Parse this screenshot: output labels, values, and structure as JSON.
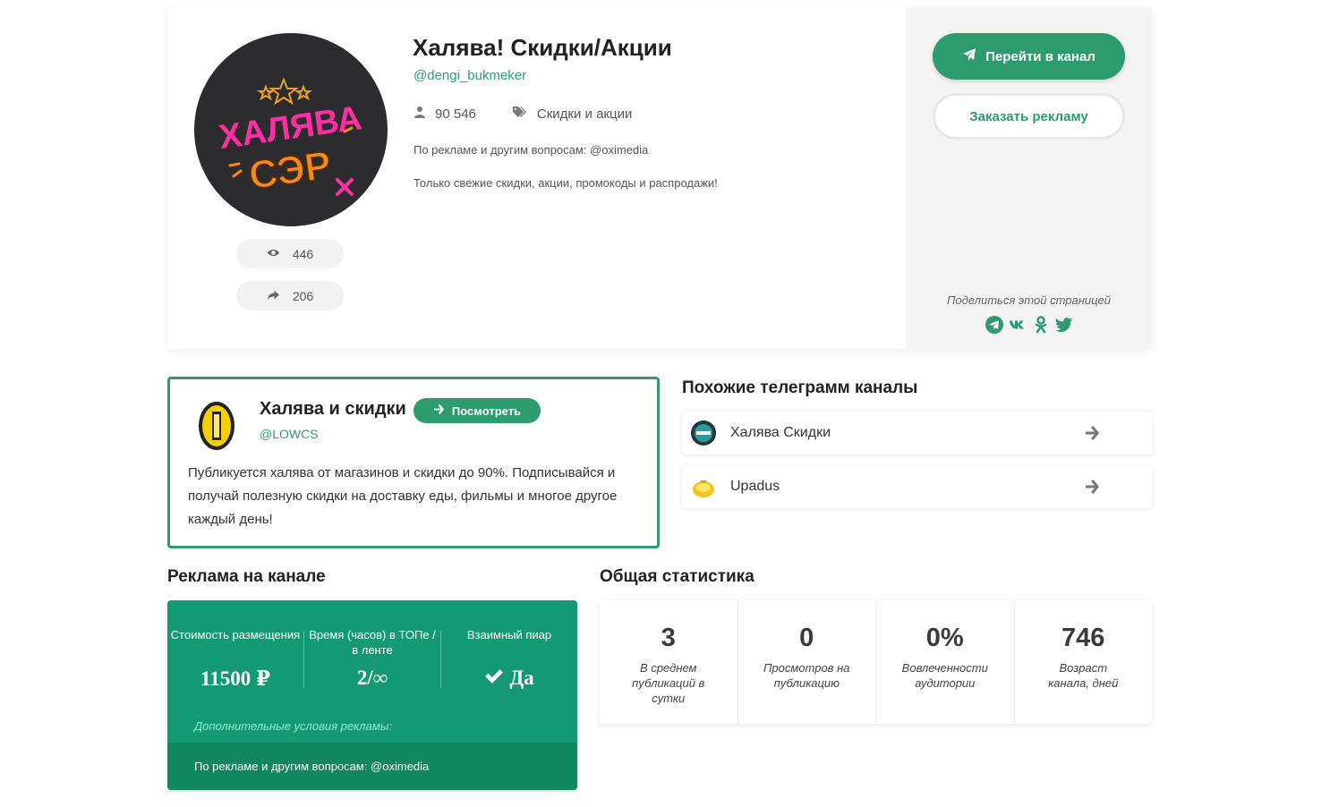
{
  "channel": {
    "title": "Халява! Скидки/Акции",
    "handle": "@dengi_bukmeker",
    "subscribers": "90 546",
    "category": "Скидки и акции",
    "ad_contact": "По рекламе и другим вопросам: @oximedia",
    "description": "Только свежие скидки, акции, промокоды и распродажи!",
    "avatar_text_top": "ХАЛЯВА",
    "avatar_text_bottom": "СЭР",
    "views": "446",
    "shares": "206"
  },
  "actions": {
    "go_channel": "Перейти в канал",
    "order_ad": "Заказать рекламу",
    "share_label": "Поделиться этой страницей",
    "share_icons": [
      "telegram-icon",
      "vk-icon",
      "odnoklassniki-icon",
      "twitter-icon"
    ]
  },
  "featured": {
    "name": "Халява и скидки",
    "handle": "@LOWCS",
    "view_label": "Посмотреть",
    "text": "Публикуется халява от магазинов и скидки до 90%. Подписывайся и получай полезную скидки на доставку еды, фильмы и многое другое каждый день!"
  },
  "similar": {
    "title": "Похожие телеграмм каналы",
    "items": [
      {
        "label": "Халява Скидки"
      },
      {
        "label": "Upadus"
      }
    ]
  },
  "ad_section": {
    "title": "Реклама на канале",
    "cost_label": "Стоимость размещения",
    "cost_value": "11500 ₽",
    "time_label": "Время (часов) в ТОПе / в ленте",
    "time_value": "2/∞",
    "mutual_label": "Взаимный пиар",
    "mutual_value": "Да",
    "extra_label": "Дополнительные условия рекламы:",
    "extra_text": "По рекламе и другим вопросам: @oximedia"
  },
  "stats": {
    "title": "Общая статистика",
    "items": [
      {
        "value": "3",
        "caption": "В среднем публикаций в сутки"
      },
      {
        "value": "0",
        "caption": "Просмотров на публикацию"
      },
      {
        "value": "0%",
        "caption": "Вовлеченности аудитории"
      },
      {
        "value": "746",
        "caption": "Возраст канала, дней"
      }
    ]
  },
  "colors": {
    "accent": "#2c9c6e",
    "ad_box": "#149a72",
    "ad_footer": "#10875f"
  }
}
